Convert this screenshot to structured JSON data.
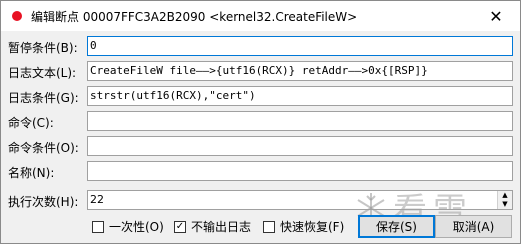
{
  "window": {
    "title": "编辑断点 00007FFC3A2B2090 <kernel32.CreateFileW>",
    "close_glyph": "✕"
  },
  "fields": [
    {
      "label": "暂停条件(B):",
      "value": "0"
    },
    {
      "label": "日志文本(L):",
      "value": "CreateFileW file——>{utf16(RCX)} retAddr——>0x{[RSP]}"
    },
    {
      "label": "日志条件(G):",
      "value": "strstr(utf16(RCX),\"cert\")"
    },
    {
      "label": "命令(C):",
      "value": ""
    },
    {
      "label": "命令条件(O):",
      "value": ""
    },
    {
      "label": "名称(N):",
      "value": ""
    }
  ],
  "hit_count": {
    "label": "执行次数(H):",
    "value": "22"
  },
  "options": {
    "once": {
      "label": "一次性(O)",
      "checked": false
    },
    "silent": {
      "label": "不输出日志",
      "checked": true
    },
    "fast_resume": {
      "label": "快速恢复(F)",
      "checked": false
    }
  },
  "buttons": {
    "save": "保存(S)",
    "cancel": "取消(A)"
  },
  "watermark": {
    "text": "看雪"
  },
  "colors": {
    "accent": "#0078d7",
    "title_icon": "#e81123"
  }
}
